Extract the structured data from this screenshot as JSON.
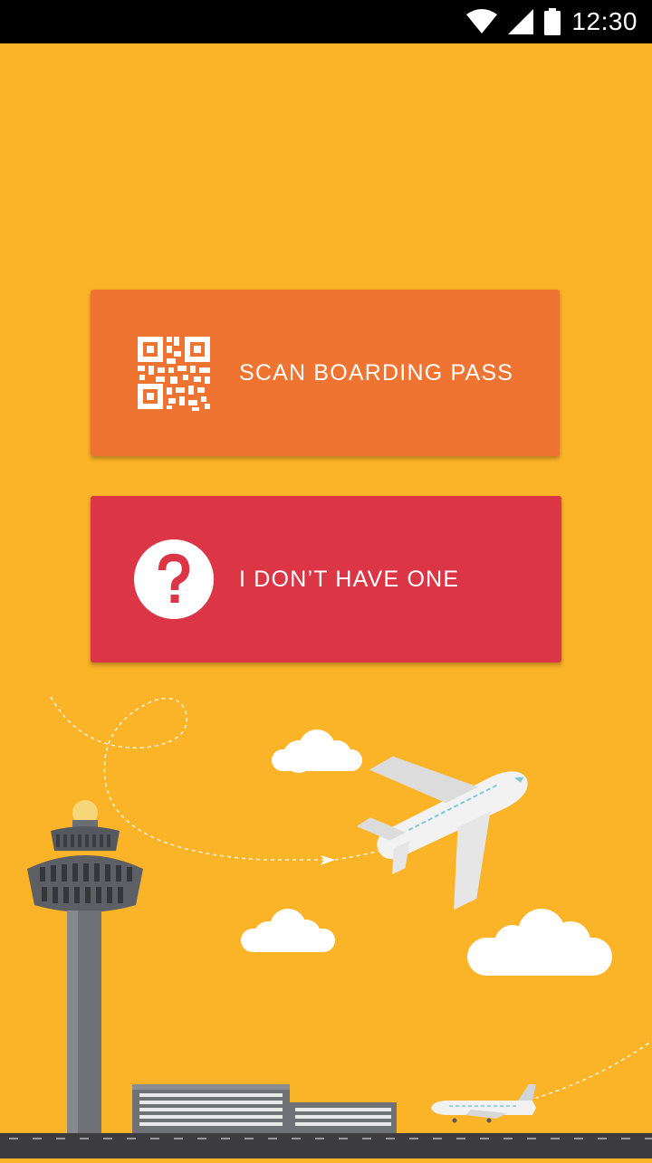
{
  "status_bar": {
    "time": "12:30",
    "icons": [
      "wifi-icon",
      "cell-signal-icon",
      "battery-icon"
    ]
  },
  "actions": {
    "scan_label": "SCAN BOARDING PASS",
    "scan_icon": "qr-code-icon",
    "no_pass_label": "I DON’T HAVE ONE",
    "no_pass_icon": "question-mark-icon"
  },
  "colors": {
    "background": "#FBB328",
    "scan_button": "#EF7431",
    "no_pass_button": "#DC3646",
    "runway": "#3C3C3F"
  },
  "illustration": {
    "elements": [
      "control-tower",
      "terminal-building",
      "airplane-flying",
      "airplane-runway",
      "clouds",
      "runway"
    ]
  }
}
